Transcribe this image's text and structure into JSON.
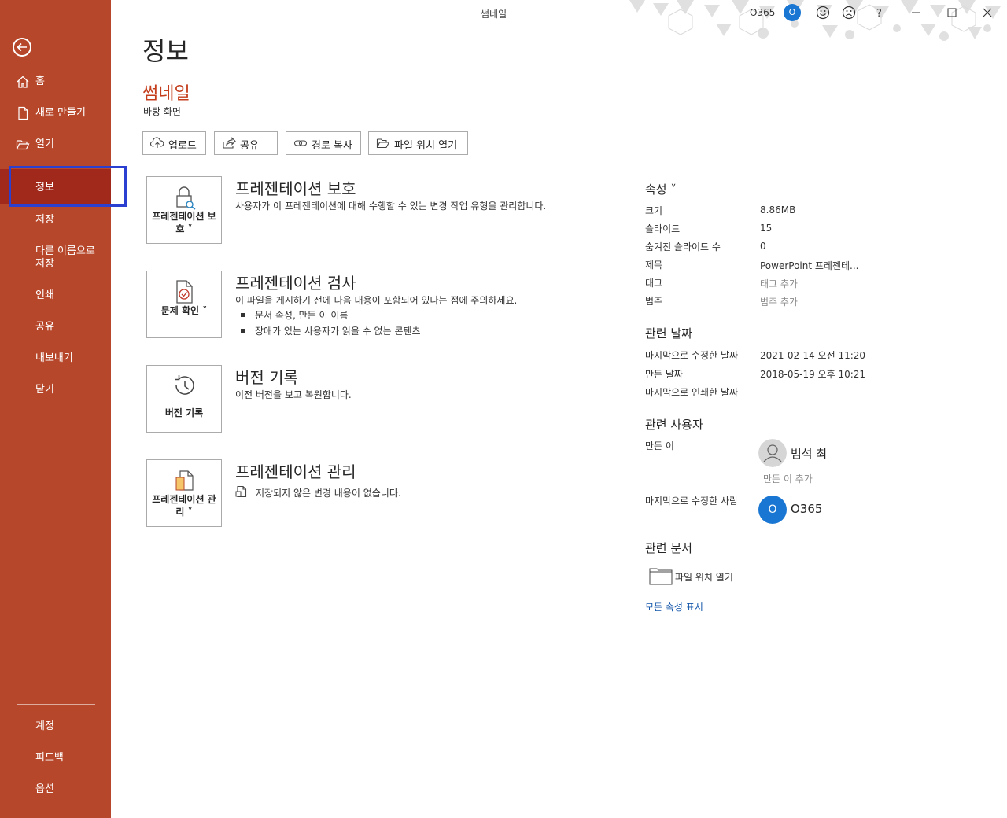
{
  "window": {
    "title": "썸네일",
    "account_name": "O365",
    "account_initial": "O"
  },
  "sidebar": {
    "items": [
      {
        "id": "home",
        "label": "홈"
      },
      {
        "id": "new",
        "label": "새로 만들기"
      },
      {
        "id": "open",
        "label": "열기"
      },
      {
        "id": "info",
        "label": "정보"
      },
      {
        "id": "save",
        "label": "저장"
      },
      {
        "id": "save-as",
        "label": "다른 이름으로 저장"
      },
      {
        "id": "print",
        "label": "인쇄"
      },
      {
        "id": "share",
        "label": "공유"
      },
      {
        "id": "export",
        "label": "내보내기"
      },
      {
        "id": "close",
        "label": "닫기"
      }
    ],
    "bottom": [
      {
        "id": "account",
        "label": "계정"
      },
      {
        "id": "feedback",
        "label": "피드백"
      },
      {
        "id": "options",
        "label": "옵션"
      }
    ],
    "active": "정보",
    "accent": "#B7472A"
  },
  "main": {
    "page_title": "정보",
    "doc_name": "썸네일",
    "doc_path": "바탕 화면",
    "actions": [
      "업로드",
      "공유",
      "경로 복사",
      "파일 위치 열기"
    ],
    "sections": [
      {
        "button_label": "프레젠테이션 보호 ˅",
        "title": "프레젠테이션 보호",
        "desc": "사용자가 이 프레젠테이션에 대해 수행할 수 있는 변경 작업 유형을 관리합니다."
      },
      {
        "button_label": "문제 확인 ˅",
        "title": "프레젠테이션 검사",
        "desc": "이 파일을 게시하기 전에 다음 내용이 포함되어 있다는 점에 주의하세요.",
        "bullets": [
          "문서 속성, 만든 이 이름",
          "장애가 있는 사용자가 읽을 수 없는 콘텐츠"
        ]
      },
      {
        "button_label": "버전 기록",
        "title": "버전 기록",
        "desc": "이전 버전을 보고 복원합니다."
      },
      {
        "button_label": "프레젠테이션 관리 ˅",
        "title": "프레젠테이션 관리",
        "desc": "저장되지 않은 변경 내용이 없습니다."
      }
    ]
  },
  "properties": {
    "header": "속성 ˅",
    "rows": [
      {
        "label": "크기",
        "value": "8.86MB"
      },
      {
        "label": "슬라이드",
        "value": "15"
      },
      {
        "label": "숨겨진 슬라이드 수",
        "value": "0"
      },
      {
        "label": "제목",
        "value": "PowerPoint 프레젠테..."
      },
      {
        "label": "태그",
        "value": "태그 추가"
      },
      {
        "label": "범주",
        "value": "범주 추가"
      }
    ],
    "dates_header": "관련 날짜",
    "dates": [
      {
        "label": "마지막으로 수정한 날짜",
        "value": "2021-02-14 오전 11:20"
      },
      {
        "label": "만든 날짜",
        "value": "2018-05-19 오후 10:21"
      },
      {
        "label": "마지막으로 인쇄한 날짜",
        "value": ""
      }
    ],
    "people_header": "관련 사용자",
    "author_label": "만든 이",
    "author_name": "범석 최",
    "add_author": "만든 이 추가",
    "modified_by_label": "마지막으로 수정한 사람",
    "modified_by_name": "O365",
    "modified_by_initial": "O",
    "docs_header": "관련 문서",
    "open_location": "파일 위치 열기",
    "show_all": "모든 속성 표시"
  }
}
